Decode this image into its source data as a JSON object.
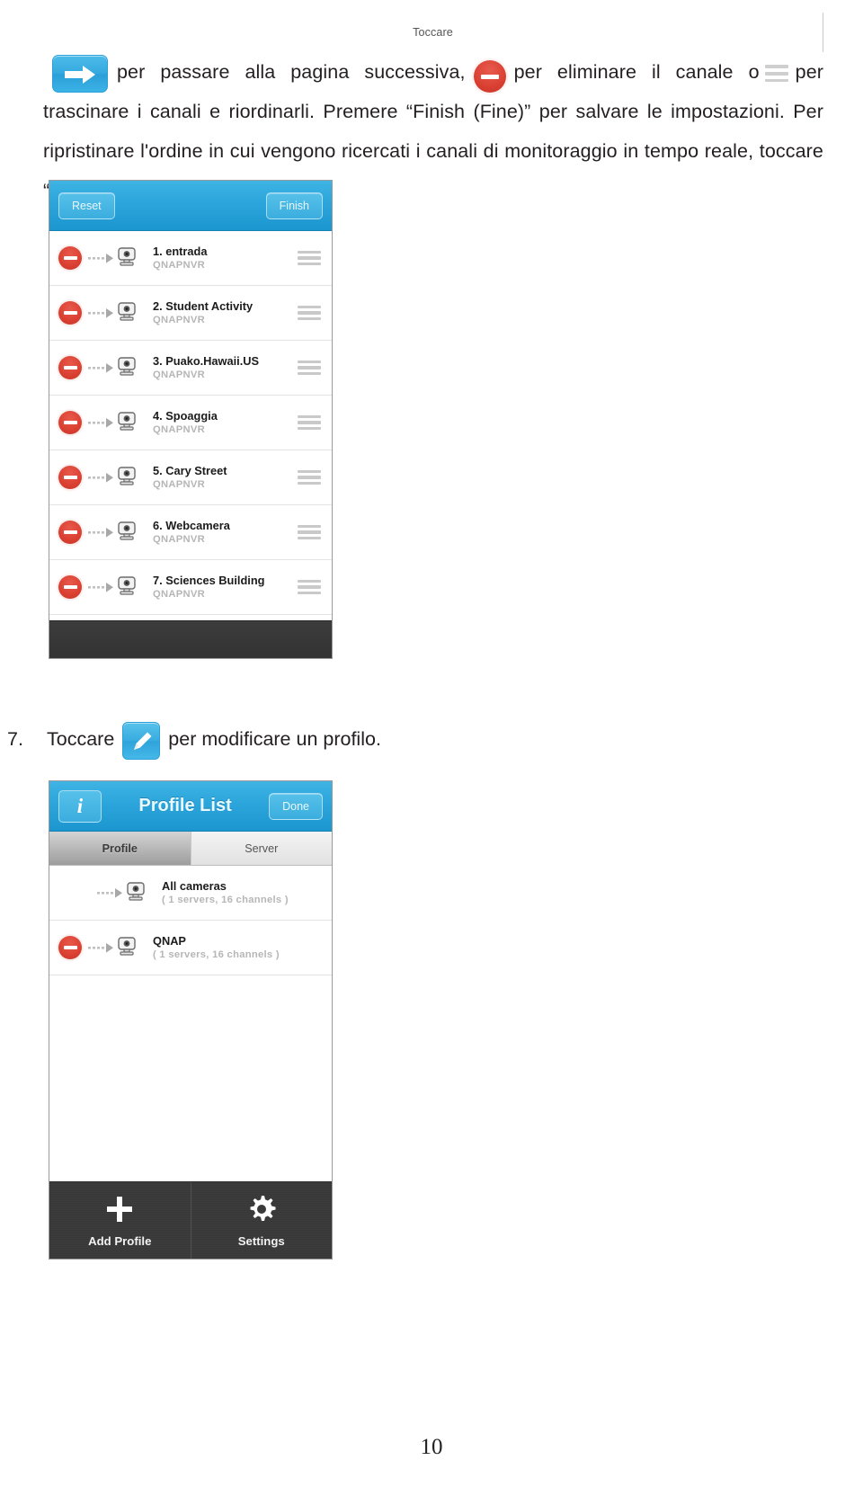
{
  "document": {
    "paragraph": {
      "p1_a": "Toccare",
      "p1_b": "per passare alla pagina successiva,",
      "p1_c": "per eliminare il canale",
      "p2_a": "o",
      "p2_b": "per trascinare i canali e riordinarli. Premere “Finish (Fine)” per salvare le impostazioni. Per ripristinare l'ordine in cui vengono ricercati i canali di monitoraggio in tempo reale, toccare “Reset”."
    },
    "step7": {
      "number": "7.",
      "text_a": "Toccare",
      "text_b": "per modificare un profilo."
    },
    "page_number": "10",
    "icons": {
      "next_page": "arrow-right-icon",
      "delete_channel": "remove-circle-icon",
      "drag_handle": "hamburger-drag-icon",
      "edit_profile": "pencil-edit-icon"
    }
  },
  "channel_screen": {
    "navbar": {
      "reset_label": "Reset",
      "finish_label": "Finish"
    },
    "rows": [
      {
        "title": "1. entrada",
        "subtitle": "QNAPNVR"
      },
      {
        "title": "2. Student Activity",
        "subtitle": "QNAPNVR"
      },
      {
        "title": "3. Puako.Hawaii.US",
        "subtitle": "QNAPNVR"
      },
      {
        "title": "4. Spoaggia",
        "subtitle": "QNAPNVR"
      },
      {
        "title": "5. Cary Street",
        "subtitle": "QNAPNVR"
      },
      {
        "title": "6. Webcamera",
        "subtitle": "QNAPNVR"
      },
      {
        "title": "7. Sciences Building",
        "subtitle": "QNAPNVR"
      }
    ]
  },
  "profile_screen": {
    "navbar": {
      "info_label": "i",
      "title": "Profile List",
      "done_label": "Done"
    },
    "tabs": [
      {
        "label": "Profile",
        "active": true
      },
      {
        "label": "Server",
        "active": false
      }
    ],
    "rows": [
      {
        "title": "All cameras",
        "subtitle": "( 1 servers, 16 channels )",
        "deletable": false
      },
      {
        "title": "QNAP",
        "subtitle": "( 1 servers, 16 channels )",
        "deletable": true
      }
    ],
    "toolbar": [
      {
        "label": "Add Profile",
        "icon": "plus-icon"
      },
      {
        "label": "Settings",
        "icon": "gear-icon"
      }
    ]
  },
  "colors": {
    "accent_blue": "#2ba5db",
    "delete_red": "#d93f31",
    "toolbar_dark": "#3a3a3a"
  }
}
